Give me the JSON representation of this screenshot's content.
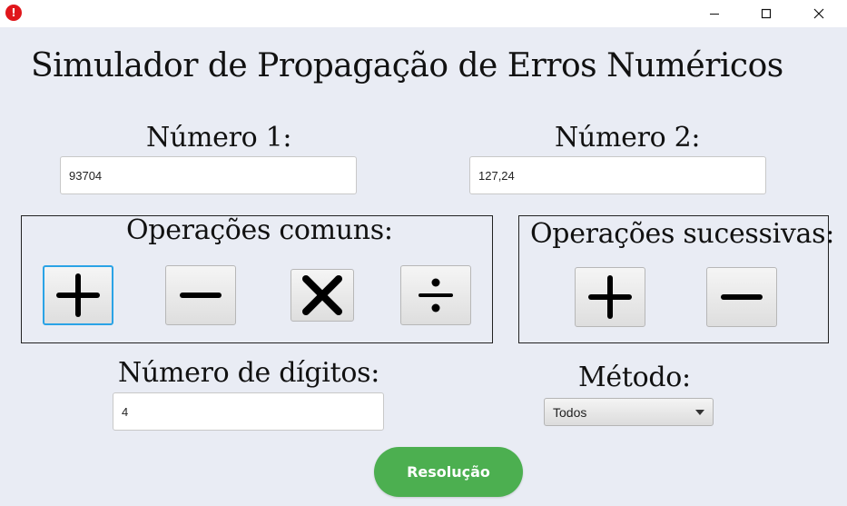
{
  "window": {
    "controls": [
      "minimize-icon",
      "maximize-icon",
      "close-icon"
    ],
    "app_icon_glyph": "!"
  },
  "app": {
    "title": "Simulador de Propagação de Erros Numéricos"
  },
  "number1": {
    "label": "Número 1:",
    "value": "93704"
  },
  "number2": {
    "label": "Número 2:",
    "value": "127,24"
  },
  "common_ops": {
    "label": "Operações comuns:",
    "buttons": [
      "plus-icon",
      "minus-icon",
      "times-icon",
      "divide-icon"
    ]
  },
  "successive_ops": {
    "label": "Operações sucessivas:",
    "buttons": [
      "plus-icon",
      "minus-icon"
    ]
  },
  "digits": {
    "label": "Número de dígitos:",
    "value": "4"
  },
  "method": {
    "label": "Método:",
    "selected": "Todos"
  },
  "resolve_button": {
    "label": "Resolução"
  },
  "colors": {
    "background": "#e9ecf4",
    "resolve_green": "#4caf50",
    "focus_blue": "#2aa3e6",
    "error_red": "#e0161b"
  }
}
